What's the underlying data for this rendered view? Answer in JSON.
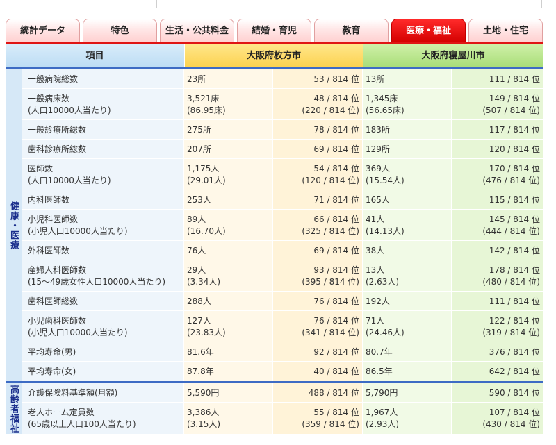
{
  "tabs": [
    {
      "label": "統計データ",
      "active": false
    },
    {
      "label": "特色",
      "active": false
    },
    {
      "label": "生活・公共料金",
      "active": false
    },
    {
      "label": "結婚・育児",
      "active": false
    },
    {
      "label": "教育",
      "active": false
    },
    {
      "label": "医療・福祉",
      "active": true
    },
    {
      "label": "土地・住宅",
      "active": false
    }
  ],
  "header": {
    "item": "項目",
    "city_a": "大阪府枚方市",
    "city_b": "大阪府寝屋川市"
  },
  "colors": {
    "tab_active": "#e01414",
    "section_bar": "#3d6bc4",
    "header_a": "#fcd24f",
    "header_b": "#a8dd78",
    "header_item": "#bcdcf4"
  },
  "sections": [
    {
      "label": "健康・医療",
      "rows": [
        {
          "item": "一般病院総数",
          "sub": "",
          "a_val": "23所",
          "a_sub": "",
          "a_rank": "53 / 814 位",
          "a_rank_sub": "",
          "b_val": "13所",
          "b_sub": "",
          "b_rank": "111 / 814 位",
          "b_rank_sub": ""
        },
        {
          "item": "一般病床数",
          "sub": "(人口10000人当たり)",
          "a_val": "3,521床",
          "a_sub": "(86.95床)",
          "a_rank": "48 / 814 位",
          "a_rank_sub": "(220 / 814 位)",
          "b_val": "1,345床",
          "b_sub": "(56.65床)",
          "b_rank": "149 / 814 位",
          "b_rank_sub": "(507 / 814 位)"
        },
        {
          "item": "一般診療所総数",
          "sub": "",
          "a_val": "275所",
          "a_sub": "",
          "a_rank": "78 / 814 位",
          "a_rank_sub": "",
          "b_val": "183所",
          "b_sub": "",
          "b_rank": "117 / 814 位",
          "b_rank_sub": ""
        },
        {
          "item": "歯科診療所総数",
          "sub": "",
          "a_val": "207所",
          "a_sub": "",
          "a_rank": "69 / 814 位",
          "a_rank_sub": "",
          "b_val": "129所",
          "b_sub": "",
          "b_rank": "120 / 814 位",
          "b_rank_sub": ""
        },
        {
          "item": "医師数",
          "sub": "(人口10000人当たり)",
          "a_val": "1,175人",
          "a_sub": "(29.01人)",
          "a_rank": "54 / 814 位",
          "a_rank_sub": "(120 / 814 位)",
          "b_val": "369人",
          "b_sub": "(15.54人)",
          "b_rank": "170 / 814 位",
          "b_rank_sub": "(476 / 814 位)"
        },
        {
          "item": "内科医師数",
          "sub": "",
          "a_val": "253人",
          "a_sub": "",
          "a_rank": "71 / 814 位",
          "a_rank_sub": "",
          "b_val": "165人",
          "b_sub": "",
          "b_rank": "115 / 814 位",
          "b_rank_sub": ""
        },
        {
          "item": "小児科医師数",
          "sub": "(小児人口10000人当たり)",
          "a_val": "89人",
          "a_sub": "(16.70人)",
          "a_rank": "66 / 814 位",
          "a_rank_sub": "(325 / 814 位)",
          "b_val": "41人",
          "b_sub": "(14.13人)",
          "b_rank": "145 / 814 位",
          "b_rank_sub": "(444 / 814 位)"
        },
        {
          "item": "外科医師数",
          "sub": "",
          "a_val": "76人",
          "a_sub": "",
          "a_rank": "69 / 814 位",
          "a_rank_sub": "",
          "b_val": "38人",
          "b_sub": "",
          "b_rank": "142 / 814 位",
          "b_rank_sub": ""
        },
        {
          "item": "産婦人科医師数",
          "sub": "(15〜49歳女性人口10000人当たり)",
          "a_val": "29人",
          "a_sub": "(3.34人)",
          "a_rank": "93 / 814 位",
          "a_rank_sub": "(395 / 814 位)",
          "b_val": "13人",
          "b_sub": "(2.63人)",
          "b_rank": "178 / 814 位",
          "b_rank_sub": "(480 / 814 位)"
        },
        {
          "item": "歯科医師総数",
          "sub": "",
          "a_val": "288人",
          "a_sub": "",
          "a_rank": "76 / 814 位",
          "a_rank_sub": "",
          "b_val": "192人",
          "b_sub": "",
          "b_rank": "111 / 814 位",
          "b_rank_sub": ""
        },
        {
          "item": "小児歯科医師数",
          "sub": "(小児人口10000人当たり)",
          "a_val": "127人",
          "a_sub": "(23.83人)",
          "a_rank": "76 / 814 位",
          "a_rank_sub": "(341 / 814 位)",
          "b_val": "71人",
          "b_sub": "(24.46人)",
          "b_rank": "122 / 814 位",
          "b_rank_sub": "(319 / 814 位)"
        },
        {
          "item": "平均寿命(男)",
          "sub": "",
          "a_val": "81.6年",
          "a_sub": "",
          "a_rank": "92 / 814 位",
          "a_rank_sub": "",
          "b_val": "80.7年",
          "b_sub": "",
          "b_rank": "376 / 814 位",
          "b_rank_sub": ""
        },
        {
          "item": "平均寿命(女)",
          "sub": "",
          "a_val": "87.8年",
          "a_sub": "",
          "a_rank": "40 / 814 位",
          "a_rank_sub": "",
          "b_val": "86.5年",
          "b_sub": "",
          "b_rank": "642 / 814 位",
          "b_rank_sub": ""
        }
      ]
    },
    {
      "label": "高齢者福祉",
      "rows": [
        {
          "item": "介護保険料基準額(月額)",
          "sub": "",
          "a_val": "5,590円",
          "a_sub": "",
          "a_rank": "488 / 814 位",
          "a_rank_sub": "",
          "b_val": "5,790円",
          "b_sub": "",
          "b_rank": "590 / 814 位",
          "b_rank_sub": ""
        },
        {
          "item": "老人ホーム定員数",
          "sub": "(65歳以上人口100人当たり)",
          "a_val": "3,386人",
          "a_sub": "(3.15人)",
          "a_rank": "55 / 814 位",
          "a_rank_sub": "(359 / 814 位)",
          "b_val": "1,967人",
          "b_sub": "(2.93人)",
          "b_rank": "107 / 814 位",
          "b_rank_sub": "(430 / 814 位)"
        }
      ]
    }
  ]
}
